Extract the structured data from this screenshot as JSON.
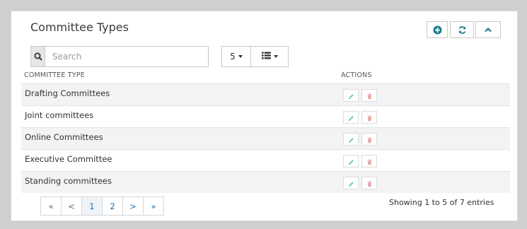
{
  "panel": {
    "title": "Committee Types",
    "header_buttons": [
      "plus-circle-icon",
      "refresh-icon",
      "chevron-up-icon"
    ]
  },
  "search": {
    "placeholder": "Search",
    "icon": "search-icon"
  },
  "page_size": {
    "value": "5"
  },
  "columns_menu": {
    "icon": "list-icon"
  },
  "table": {
    "headers": {
      "type": "COMMITTEE TYPE",
      "actions": "ACTIONS"
    },
    "rows": [
      {
        "name": "Drafting Committees"
      },
      {
        "name": "Joint committees"
      },
      {
        "name": "Online Committees"
      },
      {
        "name": "Executive Committee"
      },
      {
        "name": "Standing committees"
      }
    ]
  },
  "pagination": {
    "first": "«",
    "prev": "<",
    "pages": [
      "1",
      "2"
    ],
    "current": "1",
    "next": ">",
    "last": "»"
  },
  "info": "Showing 1 to 5 of 7 entries",
  "colors": {
    "accent": "#1a7c8c",
    "link": "#1c6fb0",
    "edit_icon": "#7ec8c8",
    "delete_icon": "#e8a0a0"
  }
}
